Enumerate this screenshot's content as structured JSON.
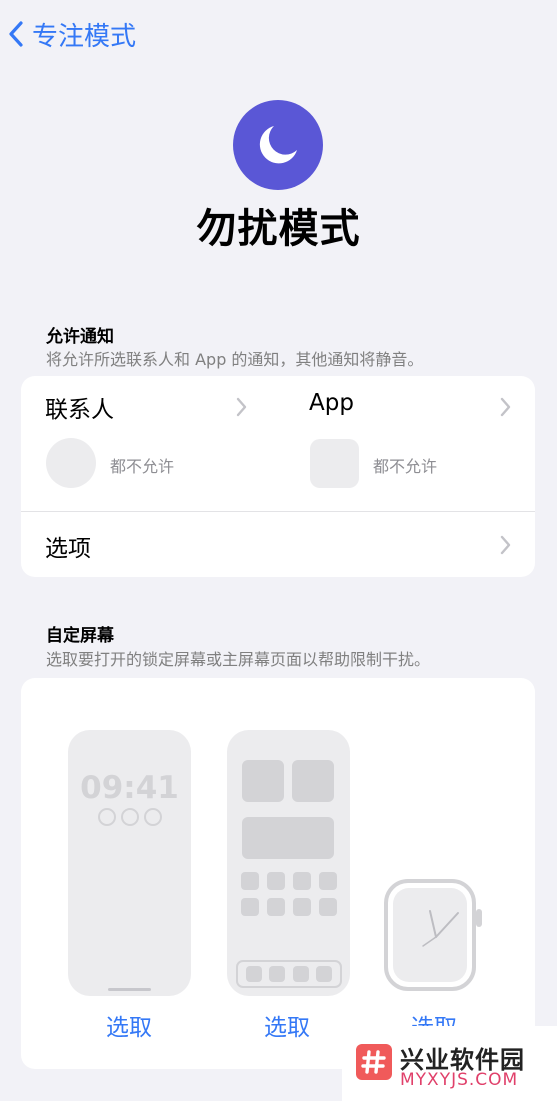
{
  "nav": {
    "back_label": "专注模式"
  },
  "header": {
    "title": "勿扰模式"
  },
  "allow_notifications": {
    "title": "允许通知",
    "subtitle": "将允许所选联系人和 App 的通知，其他通知将静音。",
    "contacts": {
      "label": "联系人",
      "status": "都不允许"
    },
    "apps": {
      "label": "App",
      "status": "都不允许"
    },
    "options_label": "选项"
  },
  "custom_screens": {
    "title": "自定屏幕",
    "subtitle": "选取要打开的锁定屏幕或主屏幕页面以帮助限制干扰。",
    "lock_screen_time": "09:41",
    "choose_labels": [
      "选取",
      "选取",
      "选取"
    ]
  },
  "watermark": {
    "name": "兴业软件园",
    "url": "MYXYJS.COM"
  },
  "colors": {
    "accent": "#3478f6",
    "focus_purple": "#5a57d6",
    "background": "#f2f2f7"
  }
}
